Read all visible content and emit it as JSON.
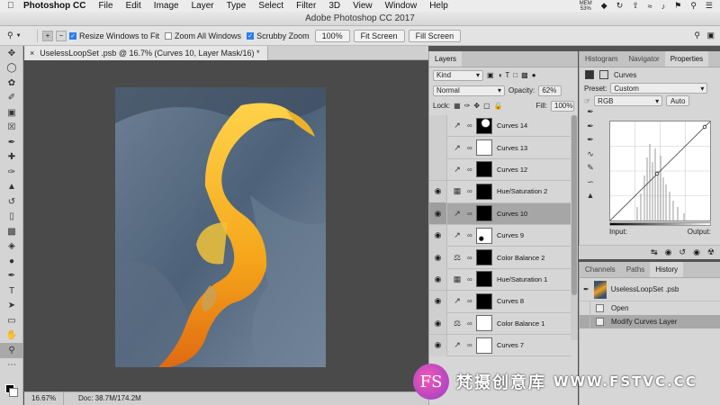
{
  "menubar": {
    "app": "Photoshop CC",
    "items": [
      "File",
      "Edit",
      "Image",
      "Layer",
      "Type",
      "Select",
      "Filter",
      "3D",
      "View",
      "Window",
      "Help"
    ],
    "mem_label": "MEM",
    "mem_value": "53%"
  },
  "window": {
    "title": "Adobe Photoshop CC 2017"
  },
  "options_bar": {
    "resize_windows": "Resize Windows to Fit",
    "zoom_all": "Zoom All Windows",
    "scrubby_zoom": "Scrubby Zoom",
    "zoom_value": "100%",
    "fit_screen": "Fit Screen",
    "fill_screen": "Fill Screen",
    "resize_checked": true,
    "zoom_all_checked": false,
    "scrubby_checked": true
  },
  "document": {
    "tab_title": "UselessLoopSet .psb @ 16.7% (Curves 10, Layer Mask/16) *",
    "zoom": "16.67%",
    "doc_info": "Doc: 38.7M/174.2M"
  },
  "layers_panel": {
    "tab": "Layers",
    "kind": "Kind",
    "blend_mode": "Normal",
    "opacity_label": "Opacity:",
    "opacity_value": "62%",
    "lock_label": "Lock:",
    "fill_label": "Fill:",
    "fill_value": "100%",
    "layers": [
      {
        "name": "Curves 14",
        "visible": false,
        "type": "curves",
        "mask": "mix",
        "selected": false
      },
      {
        "name": "Curves 13",
        "visible": false,
        "type": "curves",
        "mask": "white",
        "selected": false
      },
      {
        "name": "Curves 12",
        "visible": false,
        "type": "curves",
        "mask": "black",
        "selected": false
      },
      {
        "name": "Hue/Saturation 2",
        "visible": true,
        "type": "huesat",
        "mask": "black",
        "selected": false
      },
      {
        "name": "Curves 10",
        "visible": true,
        "type": "curves",
        "mask": "black",
        "selected": true
      },
      {
        "name": "Curves 9",
        "visible": true,
        "type": "curves",
        "mask": "mostwhite",
        "selected": false
      },
      {
        "name": "Color Balance 2",
        "visible": true,
        "type": "colorbalance",
        "mask": "black",
        "selected": false
      },
      {
        "name": "Hue/Saturation 1",
        "visible": true,
        "type": "huesat",
        "mask": "black",
        "selected": false
      },
      {
        "name": "Curves 8",
        "visible": true,
        "type": "curves",
        "mask": "black",
        "selected": false
      },
      {
        "name": "Color Balance 1",
        "visible": true,
        "type": "colorbalance",
        "mask": "white",
        "selected": false
      },
      {
        "name": "Curves 7",
        "visible": true,
        "type": "curves",
        "mask": "white",
        "selected": false
      }
    ]
  },
  "properties_panel": {
    "tabs": [
      "Histogram",
      "Navigator",
      "Properties"
    ],
    "active_tab": "Properties",
    "title": "Curves",
    "preset_label": "Preset:",
    "preset_value": "Custom",
    "channel": "RGB",
    "auto": "Auto",
    "input_label": "Input:",
    "output_label": "Output:"
  },
  "history_panel": {
    "tabs": [
      "Channels",
      "Paths",
      "History"
    ],
    "active_tab": "History",
    "snapshot": "UselessLoopSet .psb",
    "items": [
      "Open",
      "Modify Curves Layer"
    ]
  },
  "watermark": {
    "logo": "FS",
    "chinese": "梵摄创意库",
    "url": "WWW.FSTVC.CC"
  },
  "colors": {
    "accent": "#2d7bf0",
    "canvas_bg": "#4a4a4a",
    "panel_bg": "#d6d6d6",
    "selected_layer": "#a6a6a6"
  }
}
